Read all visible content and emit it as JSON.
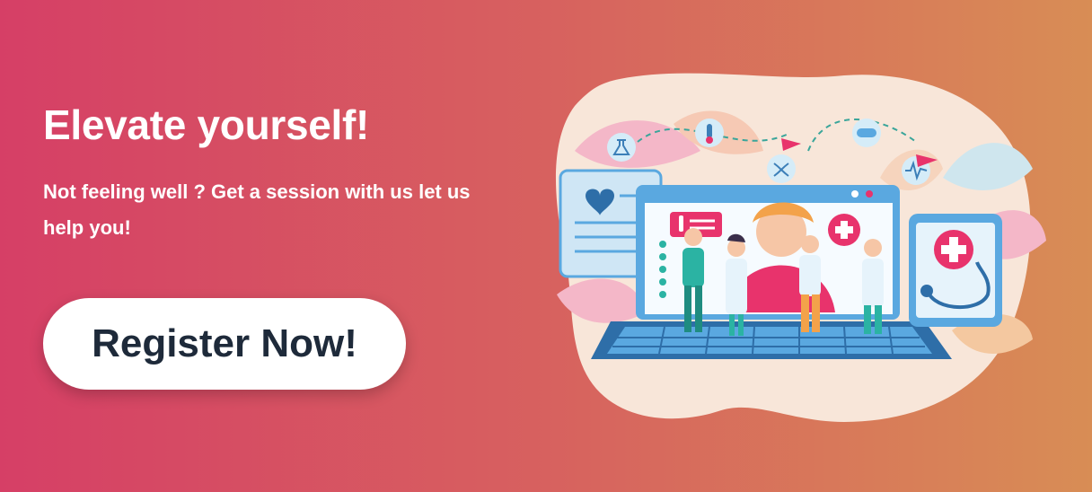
{
  "hero": {
    "title": "Elevate yourself!",
    "subtitle": "Not feeling well ? Get a session with us let us help you!",
    "cta_label": "Register Now!"
  },
  "colors": {
    "gradient_start": "#d63f66",
    "gradient_end": "#d88d55",
    "button_bg": "#ffffff",
    "button_text": "#1e2a3a",
    "accent_pink": "#e8336c",
    "accent_blue": "#5aa8e0",
    "accent_teal": "#2bb3a3"
  },
  "illustration": {
    "icons": [
      "heart-icon",
      "thermometer-icon",
      "medical-cross-icon",
      "stethoscope-icon",
      "flask-icon",
      "pill-icon",
      "dna-icon",
      "heartbeat-icon"
    ]
  }
}
